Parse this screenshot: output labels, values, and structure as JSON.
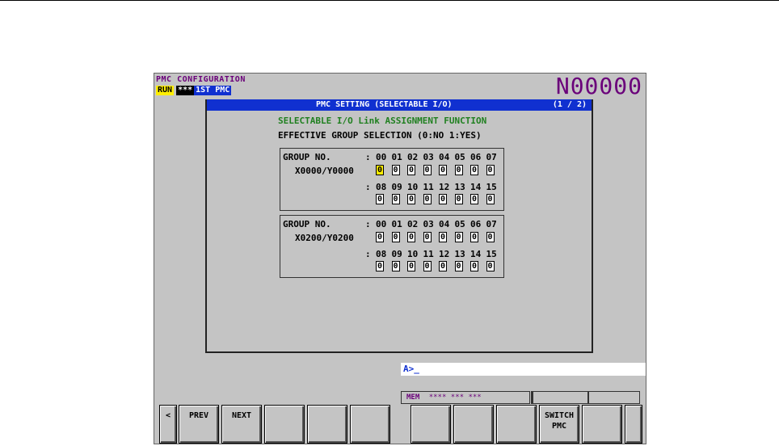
{
  "header": {
    "title": "PMC CONFIGURATION",
    "status_run": "RUN",
    "status_stars": "***",
    "status_pmc": "1ST PMC",
    "program_no": "N00000"
  },
  "panel": {
    "title": "PMC SETTING (SELECTABLE I/O)",
    "page": "(1 / 2)",
    "subtitle": "SELECTABLE I/O Link ASSIGNMENT FUNCTION",
    "selection_label": "EFFECTIVE GROUP SELECTION  (0:NO 1:YES)"
  },
  "groups": [
    {
      "label": "GROUP NO.",
      "address": "X0000/Y0000",
      "colon1": ":",
      "colon2": ":",
      "nums_a": [
        "00",
        "01",
        "02",
        "03",
        "04",
        "05",
        "06",
        "07"
      ],
      "vals_a": [
        "0",
        "0",
        "0",
        "0",
        "0",
        "0",
        "0",
        "0"
      ],
      "nums_b": [
        "08",
        "09",
        "10",
        "11",
        "12",
        "13",
        "14",
        "15"
      ],
      "vals_b": [
        "0",
        "0",
        "0",
        "0",
        "0",
        "0",
        "0",
        "0"
      ]
    },
    {
      "label": "GROUP NO.",
      "address": "X0200/Y0200",
      "colon1": ":",
      "colon2": ":",
      "nums_a": [
        "00",
        "01",
        "02",
        "03",
        "04",
        "05",
        "06",
        "07"
      ],
      "vals_a": [
        "0",
        "0",
        "0",
        "0",
        "0",
        "0",
        "0",
        "0"
      ],
      "nums_b": [
        "08",
        "09",
        "10",
        "11",
        "12",
        "13",
        "14",
        "15"
      ],
      "vals_b": [
        "0",
        "0",
        "0",
        "0",
        "0",
        "0",
        "0",
        "0"
      ]
    }
  ],
  "command_line": "A>_",
  "status_bar": {
    "mode": "MEM",
    "stars": "**** *** ***"
  },
  "softkeys": {
    "left_arrow": "<",
    "prev": "PREV",
    "next": "NEXT",
    "switch_line1": "SWITCH",
    "switch_line2": "PMC"
  },
  "colors": {
    "screen_bg": "#c4c4c4",
    "title_purple": "#6a007a",
    "bar_blue": "#1030d0",
    "highlight_yellow": "#ffee00",
    "subtitle_green": "#208020"
  }
}
